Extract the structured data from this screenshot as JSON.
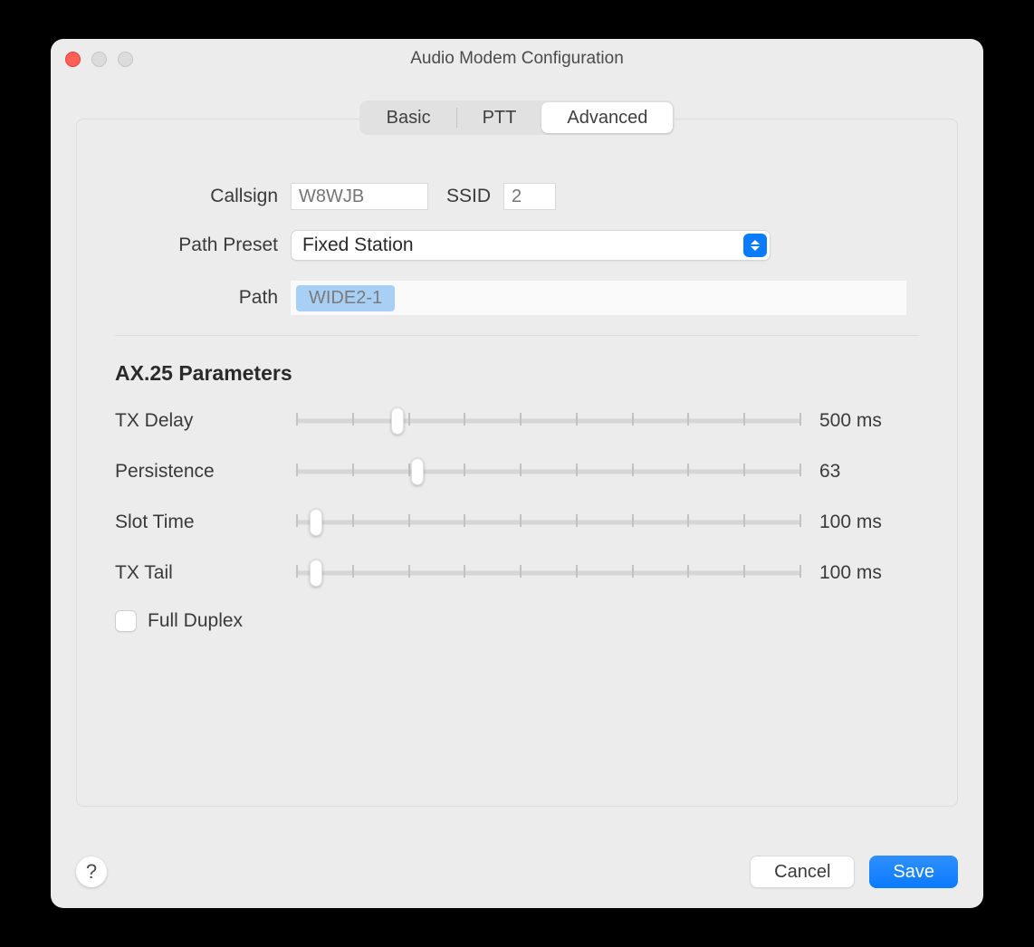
{
  "window": {
    "title": "Audio Modem Configuration"
  },
  "tabs": {
    "items": [
      "Basic",
      "PTT",
      "Advanced"
    ],
    "active": 2
  },
  "form": {
    "callsign_label": "Callsign",
    "callsign_placeholder": "W8WJB",
    "ssid_label": "SSID",
    "ssid_placeholder": "2",
    "preset_label": "Path Preset",
    "preset_value": "Fixed Station",
    "path_label": "Path",
    "path_token": "WIDE2-1"
  },
  "ax25": {
    "section_title": "AX.25 Parameters",
    "sliders": [
      {
        "label": "TX Delay",
        "value_text": "500 ms",
        "pos_pct": 20,
        "ticks": 10
      },
      {
        "label": "Persistence",
        "value_text": "63",
        "pos_pct": 24,
        "ticks": 10
      },
      {
        "label": "Slot Time",
        "value_text": "100 ms",
        "pos_pct": 4,
        "ticks": 10
      },
      {
        "label": "TX Tail",
        "value_text": "100 ms",
        "pos_pct": 4,
        "ticks": 10
      }
    ],
    "full_duplex_label": "Full Duplex",
    "full_duplex_checked": false
  },
  "footer": {
    "help_glyph": "?",
    "cancel_label": "Cancel",
    "save_label": "Save"
  }
}
